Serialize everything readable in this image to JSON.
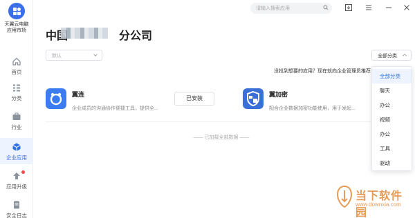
{
  "brand": {
    "name_line1": "天翼云电脑",
    "name_line2": "应用市场"
  },
  "sidebar": {
    "items": [
      {
        "label": "首页",
        "icon": "home-icon"
      },
      {
        "label": "分类",
        "icon": "category-icon"
      },
      {
        "label": "行业",
        "icon": "briefcase-icon"
      },
      {
        "label": "企业应用",
        "icon": "cube-icon",
        "active": true
      },
      {
        "label": "应用升级",
        "icon": "upgrade-arrow-icon",
        "badge": true
      },
      {
        "label": "安全日志",
        "icon": "log-icon"
      }
    ]
  },
  "topbar": {
    "search_placeholder": "请输入搜索应用"
  },
  "main": {
    "title_left": "中国",
    "title_right": "分公司",
    "filter_value": "默认",
    "category_button": "全部分类",
    "hint": "没找到想要的应用？现在就向企业管理员推荐",
    "apps": [
      {
        "name": "翼连",
        "desc": "企业成员的沟通协作便捷工具，提供全...",
        "button": "已安装"
      },
      {
        "name": "翼加密",
        "desc": "配合企业数据加密功能使用，用于发起..."
      }
    ],
    "loaded_text": "—— 已加载全部数据 ——"
  },
  "dropdown": {
    "options": [
      "全部分类",
      "聊天",
      "办公",
      "视频",
      "办公",
      "工具",
      "驱动"
    ],
    "selected_index": 0
  },
  "watermark": {
    "name": "当下软件园",
    "url": "www.downxia.com"
  },
  "colors": {
    "accent": "#2f6fe6",
    "brand": "#3b6fe8",
    "badge": "#f04848",
    "watermark": "#e28b3a"
  }
}
